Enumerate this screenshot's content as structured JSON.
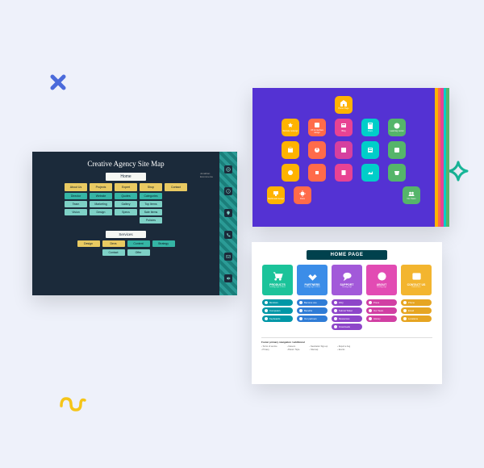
{
  "decorations": {
    "x_color": "#4b6bdb",
    "star_color": "#19b89a",
    "squiggle_color": "#f5c518"
  },
  "card1": {
    "title": "Creative Agency Site Map",
    "root": "Home",
    "meta1": "Jonathan",
    "meta2": "Ecommerce",
    "topRow": [
      "About Us",
      "Projects",
      "Expert",
      "Shop",
      "Contact"
    ],
    "cols": [
      [
        "Director",
        "Team",
        "Vision"
      ],
      [
        "Website",
        "Marketing",
        "Design"
      ],
      [
        "Quotes",
        "Gallery",
        "Specs"
      ],
      [
        "Categories",
        "Top Items",
        "Sale Items",
        "Policies"
      ],
      []
    ],
    "services": "Services",
    "svcTop": [
      "Design",
      "Devs",
      "Content",
      "Strategy"
    ],
    "svcBot": [
      "Contact",
      "Offer"
    ]
  },
  "card2": {
    "root": "Home Page",
    "row1": [
      "Website redesign",
      "UX & interface design",
      "Blog",
      "Docs",
      "Learning center"
    ],
    "row2": [
      "",
      "",
      "",
      "",
      ""
    ],
    "row3": [
      "",
      "",
      "",
      "",
      ""
    ],
    "row4_left": [
      "Dashboard design",
      "Docs"
    ],
    "row4_right": "Our Team"
  },
  "card3": {
    "title": "HOME PAGE",
    "heads": [
      {
        "label": "PRODUCTS",
        "sub": "Landing page w/ filters"
      },
      {
        "label": "PARTNERS",
        "sub": "Landing page w/ filters"
      },
      {
        "label": "SUPPORT",
        "sub": "Landing page"
      },
      {
        "label": "ABOUT",
        "sub": "Landing page"
      },
      {
        "label": "CONTACT US",
        "sub": "Embed form"
      }
    ],
    "cols": [
      [
        "Monitors",
        "Computers",
        "Keyboards"
      ],
      [
        "Become one",
        "Benefits",
        "Our partners"
      ],
      [
        "FAQ",
        "Submit Ticket",
        "Resources",
        "Downloads"
      ],
      [
        "Press",
        "Our Team",
        "History"
      ],
      [
        "Phone",
        "Email",
        "Locations"
      ]
    ],
    "footerTitle": "Footer primary navigation / additional",
    "footerCols": [
      [
        "Terms of service",
        "Privacy"
      ],
      [
        "Careers",
        "Brand / Style"
      ],
      [
        "Newsletter Sign-up",
        "Sitemap"
      ],
      [
        "Report a bug",
        "Events"
      ]
    ]
  }
}
